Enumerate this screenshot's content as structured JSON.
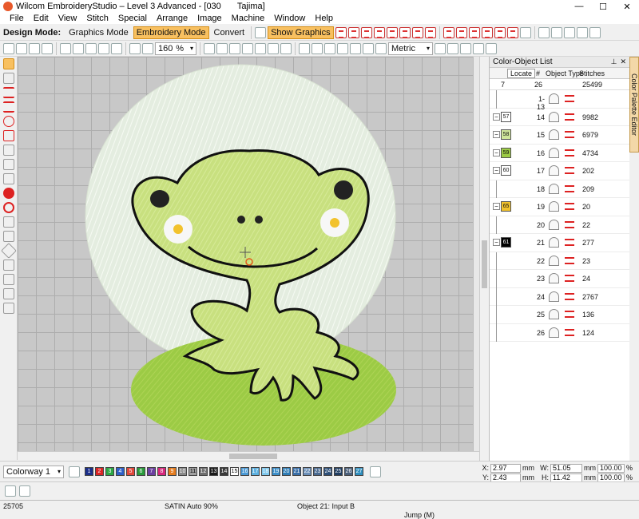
{
  "titlebar": {
    "title": "Wilcom EmbroideryStudio – Level 3 Advanced - [030",
    "machine": "Tajima]",
    "minimize": "—",
    "maximize": "☐",
    "close": "✕"
  },
  "menu": [
    "File",
    "Edit",
    "View",
    "Stitch",
    "Special",
    "Arrange",
    "Image",
    "Machine",
    "Window",
    "Help"
  ],
  "toolbar": {
    "design_mode_label": "Design Mode:",
    "graphics_mode": "Graphics Mode",
    "embroidery_mode": "Embroidery Mode",
    "convert": "Convert",
    "show_graphics": "Show Graphics",
    "zoom_value": "160",
    "zoom_pct": "%",
    "units": "Metric"
  },
  "panel": {
    "title": "Color-Object List",
    "locate": "Locate",
    "col_num": "#",
    "col_type": "Object Type",
    "col_stitches": "Stitches",
    "summary": {
      "colors": "7",
      "objects": "26",
      "stitches": "25499"
    },
    "rows": [
      {
        "color": "",
        "color_hex": "",
        "num": "1-13",
        "stitches": ""
      },
      {
        "color": "57",
        "color_hex": "#ffffff",
        "num": "14",
        "stitches": "9982"
      },
      {
        "color": "58",
        "color_hex": "#cfe69b",
        "num": "15",
        "stitches": "6979"
      },
      {
        "color": "59",
        "color_hex": "#9ccb45",
        "num": "16",
        "stitches": "4734"
      },
      {
        "color": "60",
        "color_hex": "#ffffff",
        "num": "17",
        "stitches": "202"
      },
      {
        "color": "",
        "color_hex": "",
        "num": "18",
        "stitches": "209"
      },
      {
        "color": "65",
        "color_hex": "#f2c22d",
        "num": "19",
        "stitches": "20"
      },
      {
        "color": "",
        "color_hex": "",
        "num": "20",
        "stitches": "22"
      },
      {
        "color": "61",
        "color_hex": "#000000",
        "num": "21",
        "stitches": "277"
      },
      {
        "color": "",
        "color_hex": "",
        "num": "22",
        "stitches": "23"
      },
      {
        "color": "",
        "color_hex": "",
        "num": "23",
        "stitches": "24"
      },
      {
        "color": "",
        "color_hex": "",
        "num": "24",
        "stitches": "2767"
      },
      {
        "color": "",
        "color_hex": "",
        "num": "25",
        "stitches": "136"
      },
      {
        "color": "",
        "color_hex": "",
        "num": "26",
        "stitches": "124"
      }
    ]
  },
  "side_tab": "Color Palette Editor",
  "colorway": "Colorway 1",
  "swatches": [
    {
      "n": "1",
      "hex": "#1c2f8a"
    },
    {
      "n": "2",
      "hex": "#d92525"
    },
    {
      "n": "3",
      "hex": "#2ca845"
    },
    {
      "n": "4",
      "hex": "#2e5fc7"
    },
    {
      "n": "5",
      "hex": "#e0473a"
    },
    {
      "n": "6",
      "hex": "#2a9c3c"
    },
    {
      "n": "7",
      "hex": "#6b3fa0"
    },
    {
      "n": "8",
      "hex": "#d6277b"
    },
    {
      "n": "9",
      "hex": "#e57c1f"
    },
    {
      "n": "10",
      "hex": "#8a8a8a"
    },
    {
      "n": "11",
      "hex": "#a0a0a0"
    },
    {
      "n": "12",
      "hex": "#6e6e6e"
    },
    {
      "n": "13",
      "hex": "#1a1a1a"
    },
    {
      "n": "14",
      "hex": "#3a3a3a"
    },
    {
      "n": "15",
      "hex": "#ffffff"
    },
    {
      "n": "16",
      "hex": "#4b9ad6"
    },
    {
      "n": "17",
      "hex": "#5bb0e0"
    },
    {
      "n": "18",
      "hex": "#7ec7ec"
    },
    {
      "n": "19",
      "hex": "#3b8ec9"
    },
    {
      "n": "20",
      "hex": "#2e7cb5"
    },
    {
      "n": "21",
      "hex": "#3a6fa8"
    },
    {
      "n": "22",
      "hex": "#6b8fb8"
    },
    {
      "n": "23",
      "hex": "#4a6a90"
    },
    {
      "n": "24",
      "hex": "#2d4f78"
    },
    {
      "n": "25",
      "hex": "#1e3c60"
    },
    {
      "n": "26",
      "hex": "#4a5f7a"
    },
    {
      "n": "27",
      "hex": "#2f8fbf"
    }
  ],
  "coords": {
    "x_label": "X:",
    "x_value": "2.97",
    "x_unit": "mm",
    "y_label": "Y:",
    "y_value": "2.43",
    "y_unit": "mm",
    "w_label": "W:",
    "w_value": "51.05",
    "w_unit": "mm",
    "w_pct": "100.00",
    "w_pct_unit": "%",
    "h_label": "H:",
    "h_value": "11.42",
    "h_unit": "mm",
    "h_pct": "100.00",
    "h_pct_unit": "%"
  },
  "status": {
    "stitch_count": "25705",
    "stitch_type": "SATIN Auto 90%",
    "object_info": "Object 21: Input B",
    "jump": "Jump (M)"
  }
}
